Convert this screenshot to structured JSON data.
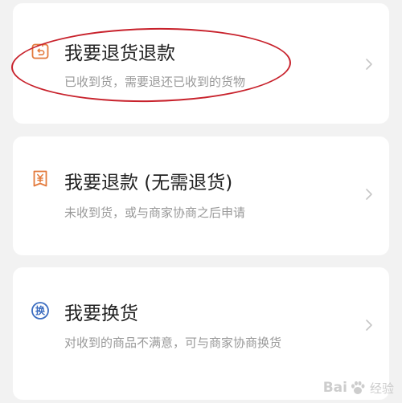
{
  "options": [
    {
      "icon": "return-package-icon",
      "title": "我要退货退款",
      "subtitle": "已收到货，需要退还已收到的货物"
    },
    {
      "icon": "yen-refund-icon",
      "title": "我要退款 (无需退货)",
      "subtitle": "未收到货，或与商家协商之后申请"
    },
    {
      "icon": "exchange-icon",
      "icon_char": "换",
      "title": "我要换货",
      "subtitle": "对收到的商品不满意，可与商家协商换货"
    }
  ],
  "colors": {
    "icon_orange": "#e37a3c",
    "icon_blue": "#3c6dc0",
    "annotation_red": "#c8222c"
  },
  "watermark": {
    "brand": "Bai",
    "brand2": "经验"
  }
}
